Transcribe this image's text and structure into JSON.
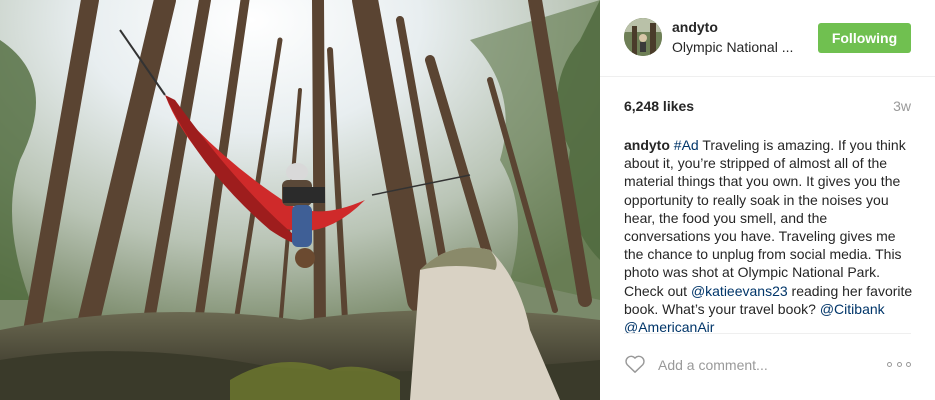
{
  "post": {
    "username": "andyto",
    "location": "Olympic National ...",
    "follow_label": "Following",
    "likes": "6,248 likes",
    "time_ago": "3w",
    "caption": {
      "username": "andyto",
      "hashtag": "#Ad",
      "text_1": " Traveling is amazing. If you think about it, you’re stripped of almost all of the material things that you own. It gives you the opportunity to really soak in the noises you hear, the food you smell, and the conversations you have. Traveling gives me the chance to unplug from social media. This photo was shot at Olympic National Park. Check out ",
      "mention_1": "@katieevans23",
      "text_2": " reading her favorite book. What’s your travel book? ",
      "mention_2": "@Citibank",
      "mention_3": "@AmericanAir"
    },
    "comment_placeholder": "Add a comment...",
    "colors": {
      "follow_button": "#70c050",
      "link": "#003569",
      "muted": "#999999"
    },
    "icons": {
      "like": "heart-icon",
      "more": "more-options-icon"
    }
  }
}
